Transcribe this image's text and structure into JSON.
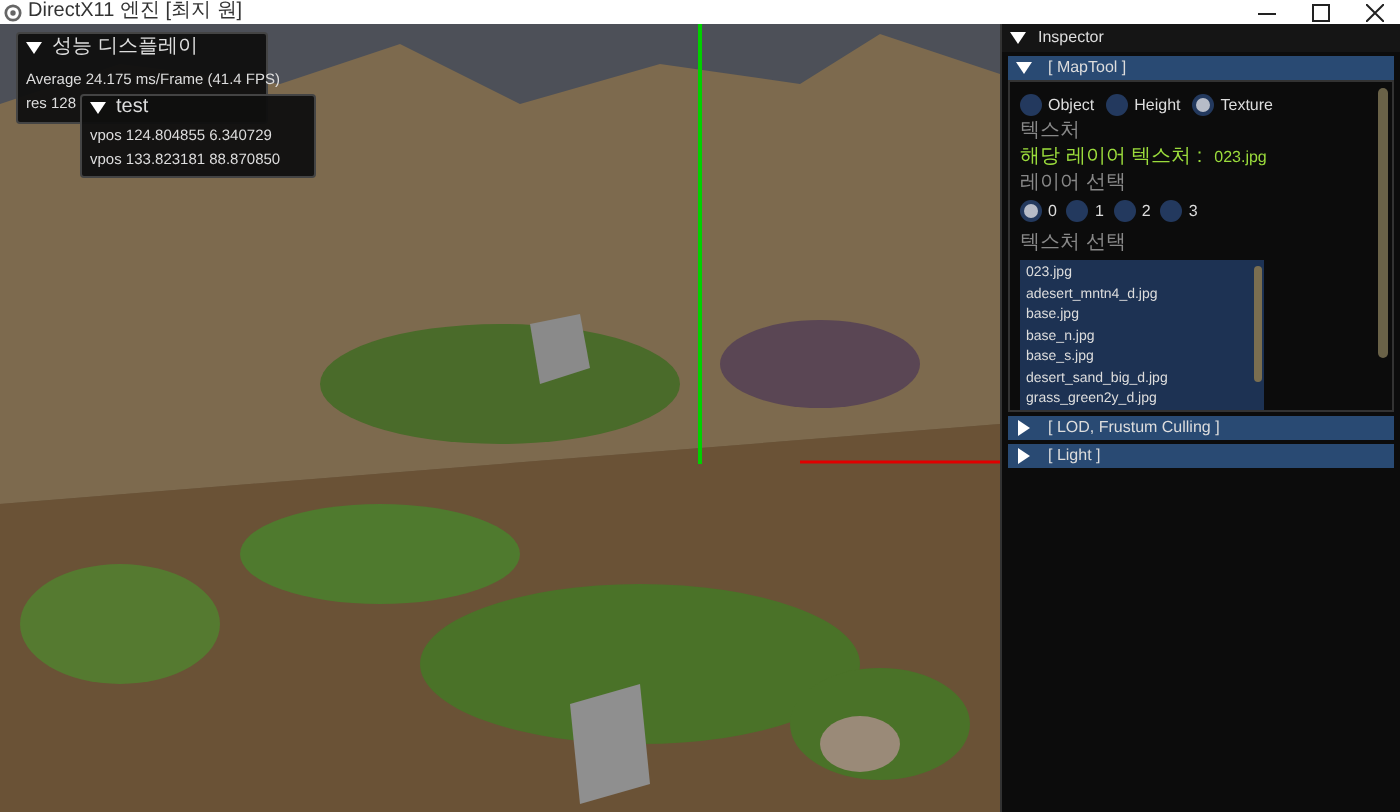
{
  "window": {
    "title": "DirectX11 엔진 [최지 원]"
  },
  "perf_overlay": {
    "title": "성능 디스플레이",
    "expanded": true,
    "lines": [
      "Average 24.175 ms/Frame (41.4 FPS)",
      "res 128"
    ]
  },
  "test_overlay": {
    "title": "test",
    "expanded": true,
    "lines": [
      "vpos 124.804855 6.340729",
      "vpos 133.823181 88.870850"
    ]
  },
  "inspector": {
    "title": "Inspector",
    "expanded": true,
    "sections": [
      {
        "label": "[ MapTool ]",
        "expanded": true
      },
      {
        "label": "[ LOD, Frustum Culling ]",
        "expanded": false
      },
      {
        "label": "[ Light ]",
        "expanded": false
      }
    ],
    "mode_radios": [
      {
        "label": "Object",
        "selected": false
      },
      {
        "label": "Height",
        "selected": false
      },
      {
        "label": "Texture",
        "selected": true
      }
    ],
    "texture_heading": "텍스처",
    "layer_texture": {
      "label": "해당 레이어 텍스처 :",
      "value": "023.jpg"
    },
    "layer_heading": "레이어 선택",
    "layer_radios": [
      {
        "label": "0",
        "selected": true
      },
      {
        "label": "1",
        "selected": false
      },
      {
        "label": "2",
        "selected": false
      },
      {
        "label": "3",
        "selected": false
      }
    ],
    "texture_list_heading": "텍스처 선택",
    "texture_list": [
      "023.jpg",
      "adesert_mntn4_d.jpg",
      "base.jpg",
      "base_n.jpg",
      "base_s.jpg",
      "desert_sand_big_d.jpg",
      "grass_green2y_d.jpg"
    ]
  }
}
